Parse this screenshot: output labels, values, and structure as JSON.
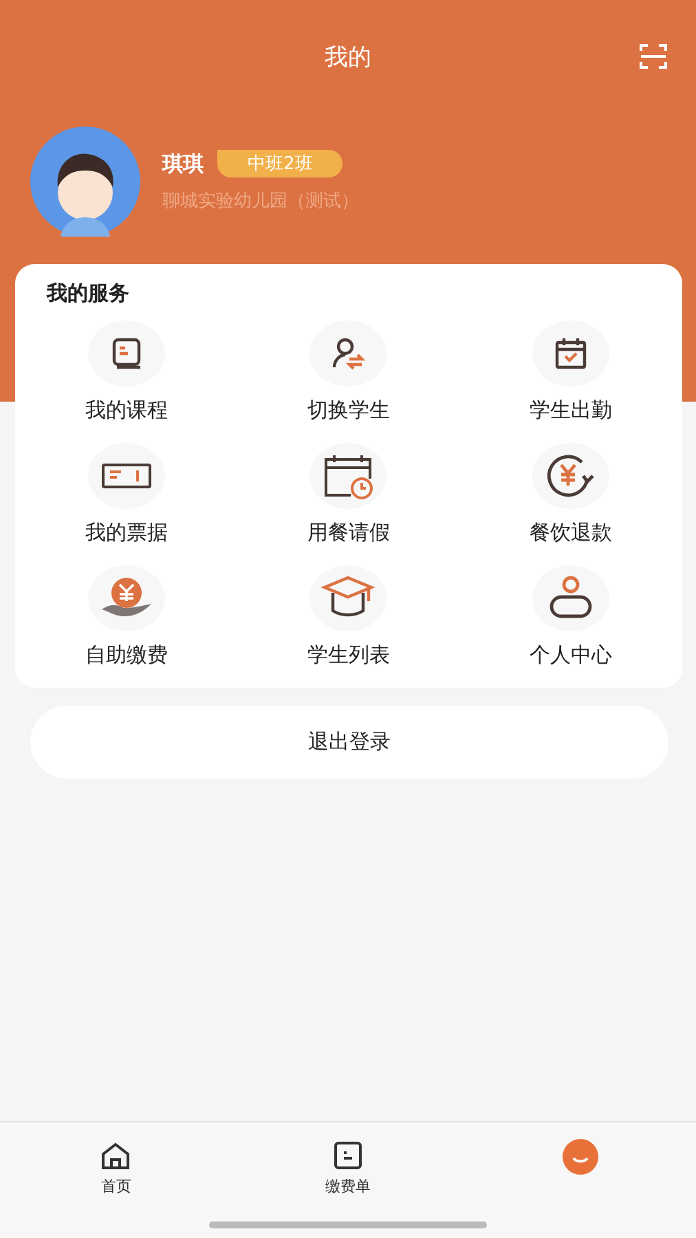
{
  "header": {
    "title": "我的"
  },
  "profile": {
    "name": "琪琪",
    "class_badge": "中班2班",
    "school": "聊城实验幼儿园（测试）"
  },
  "services": {
    "title": "我的服务",
    "items": [
      {
        "label": "我的课程",
        "kind": "book"
      },
      {
        "label": "切换学生",
        "kind": "switch"
      },
      {
        "label": "学生出勤",
        "kind": "calendar"
      },
      {
        "label": "我的票据",
        "kind": "ticket"
      },
      {
        "label": "用餐请假",
        "kind": "clock"
      },
      {
        "label": "餐饮退款",
        "kind": "refund"
      },
      {
        "label": "自助缴费",
        "kind": "pay"
      },
      {
        "label": "学生列表",
        "kind": "cap"
      },
      {
        "label": "个人中心",
        "kind": "person"
      }
    ]
  },
  "logout_button": "退出登录",
  "tab_bar": [
    {
      "label": "首页",
      "kind": "home",
      "selected": false
    },
    {
      "label": "缴费单",
      "kind": "bill",
      "selected": false
    },
    {
      "kind": "me",
      "selected": true
    }
  ]
}
